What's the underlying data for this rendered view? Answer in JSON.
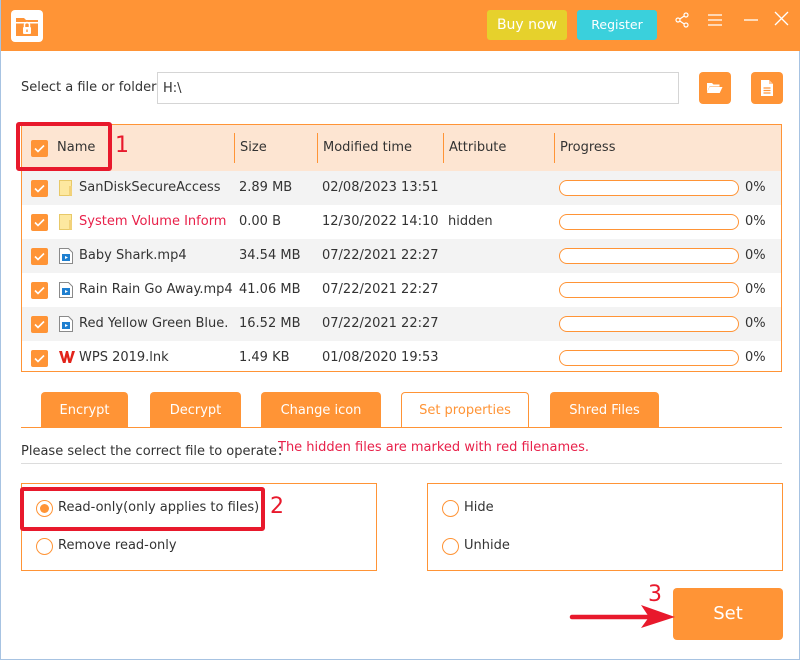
{
  "titlebar": {
    "buy_label": "Buy now",
    "register_label": "Register",
    "icons": [
      "share-icon",
      "menu-icon",
      "minimize-icon",
      "close-icon"
    ]
  },
  "path": {
    "label": "Select a file or folder:",
    "value": "H:\\",
    "browse_folder_icon": "folder-open-icon",
    "browse_file_icon": "file-icon"
  },
  "table": {
    "headers": {
      "name": "Name",
      "size": "Size",
      "modified": "Modified time",
      "attribute": "Attribute",
      "progress": "Progress"
    },
    "select_all_checked": true,
    "rows": [
      {
        "name": "SanDiskSecureAccess",
        "size": "2.89 MB",
        "modified": "02/08/2023 13:51",
        "attribute": "",
        "progress": 0,
        "progress_label": "0%",
        "icon": "folder-icon",
        "hidden": false,
        "checked": true
      },
      {
        "name": "System Volume Inform",
        "size": "0.00 B",
        "modified": "12/30/2022 14:10",
        "attribute": "hidden",
        "progress": 0,
        "progress_label": "0%",
        "icon": "folder-icon",
        "hidden": true,
        "checked": true
      },
      {
        "name": "Baby Shark.mp4",
        "size": "34.54 MB",
        "modified": "07/22/2021 22:27",
        "attribute": "",
        "progress": 0,
        "progress_label": "0%",
        "icon": "video-file-icon",
        "hidden": false,
        "checked": true
      },
      {
        "name": "Rain Rain Go Away.mp4",
        "size": "41.06 MB",
        "modified": "07/22/2021 22:27",
        "attribute": "",
        "progress": 0,
        "progress_label": "0%",
        "icon": "video-file-icon",
        "hidden": false,
        "checked": true
      },
      {
        "name": "Red Yellow Green Blue.",
        "size": "16.52 MB",
        "modified": "07/22/2021 22:27",
        "attribute": "",
        "progress": 0,
        "progress_label": "0%",
        "icon": "video-file-icon",
        "hidden": false,
        "checked": true
      },
      {
        "name": "WPS 2019.lnk",
        "size": "1.49 KB",
        "modified": "01/08/2020 19:53",
        "attribute": "",
        "progress": 0,
        "progress_label": "0%",
        "icon": "wps-icon",
        "hidden": false,
        "checked": true
      }
    ]
  },
  "tabs": [
    {
      "label": "Encrypt",
      "active": false
    },
    {
      "label": "Decrypt",
      "active": false
    },
    {
      "label": "Change icon",
      "active": false
    },
    {
      "label": "Set properties",
      "active": true
    },
    {
      "label": "Shred Files",
      "active": false
    }
  ],
  "hint": {
    "text": "Please select the correct file to operate：",
    "warning": "The hidden files are marked with red filenames."
  },
  "options": {
    "readonly_group": [
      {
        "label": "Read-only(only applies to files)",
        "selected": true
      },
      {
        "label": "Remove read-only",
        "selected": false
      }
    ],
    "hide_group": [
      {
        "label": "Hide",
        "selected": false
      },
      {
        "label": "Unhide",
        "selected": false
      }
    ]
  },
  "set_label": "Set",
  "annotations": [
    "1",
    "2",
    "3"
  ],
  "colors": {
    "accent": "#ff9436",
    "hidden_file": "#e8214a",
    "buy": "#e6d12c",
    "register": "#3ad0dc",
    "annotation": "#e8192c"
  }
}
